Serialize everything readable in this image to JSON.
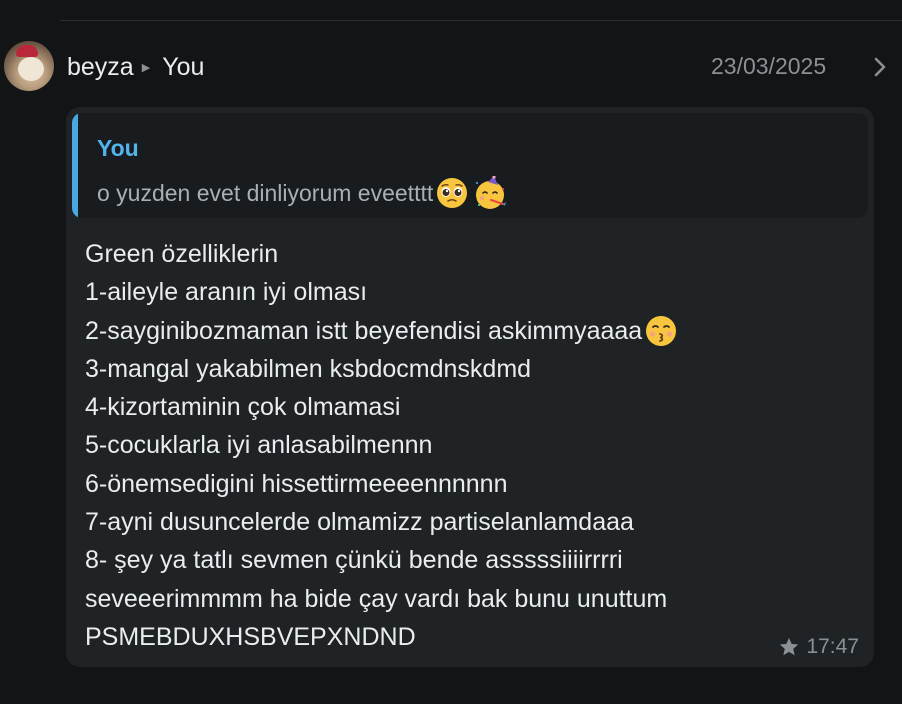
{
  "header": {
    "sender": "beyza",
    "recipient": "You",
    "date": "23/03/2025"
  },
  "quote": {
    "author": "You",
    "text": "o yuzden evet dinliyorum eveetttt",
    "emojis": [
      "pleading-face-icon",
      "partying-face-icon"
    ]
  },
  "message": {
    "lines": [
      "Green özelliklerin",
      "1-aileyle aranın iyi olması",
      "2-sayginibozmaman istt beyefendisi askimmyaaaa",
      "3-mangal yakabilmen ksbdocmdnskdmd",
      "4-kizortaminin çok olmamasi",
      "5-cocuklarla iyi anlasabilmennn",
      "6-önemsedigini hissettirmeeeennnnnn",
      "7-ayni dusuncelerde olmamizz partiselanlamdaaa",
      "8- şey ya tatlı sevmen çünkü bende asssssiiiirrrri",
      "seveeerimmmm ha bide çay vardı bak bunu unuttum",
      "PSMEBDUXHSBVEPXNDND"
    ],
    "line2_emoji": "kissing-face-icon",
    "time": "17:47",
    "starred": true
  },
  "colors": {
    "background": "#121416",
    "bubble": "#1f2326",
    "quote_bar": "#4aa8e0",
    "quote_author": "#53b3eb"
  }
}
